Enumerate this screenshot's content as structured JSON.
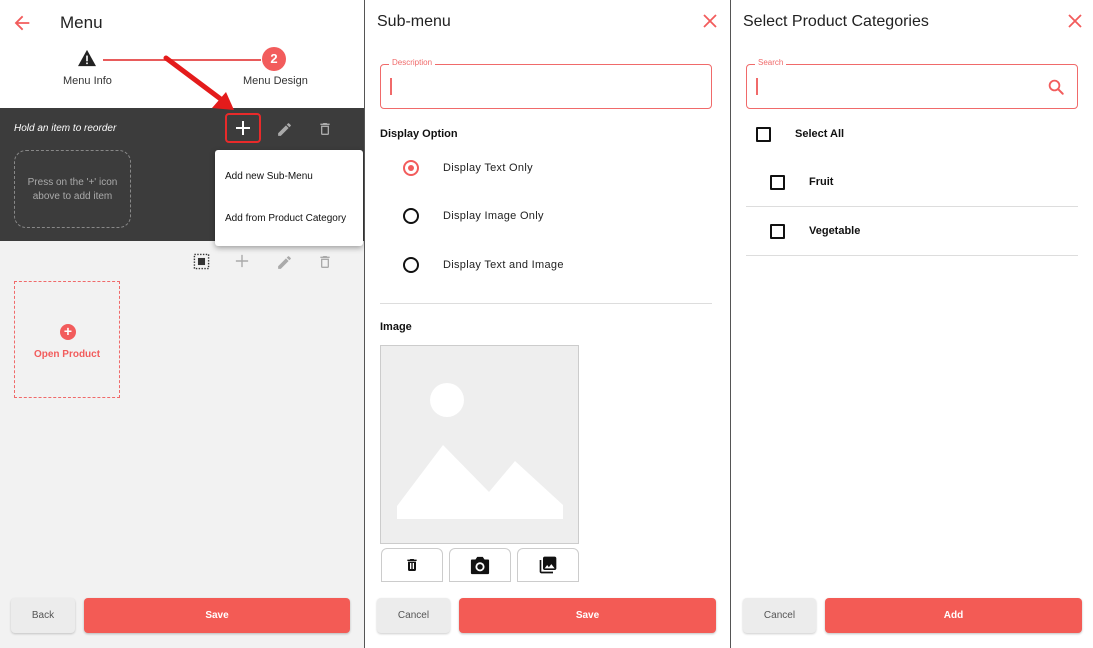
{
  "menu_screen": {
    "title": "Menu",
    "steps": [
      {
        "label": "Menu Info"
      },
      {
        "label": "Menu Design",
        "number": "2"
      }
    ],
    "toolbar_hint": "Hold an item to reorder",
    "empty_placeholder": "Press on the '+' icon above to add item",
    "context_menu": {
      "items": [
        "Add new Sub-Menu",
        "Add from Product Category"
      ]
    },
    "open_product_label": "Open Product",
    "back_label": "Back",
    "save_label": "Save"
  },
  "submenu_screen": {
    "title": "Sub-menu",
    "description_label": "Description",
    "description_value": "",
    "display_option_title": "Display Option",
    "display_options": [
      {
        "label": "Display Text Only",
        "selected": true
      },
      {
        "label": "Display Image Only",
        "selected": false
      },
      {
        "label": "Display Text and Image",
        "selected": false
      }
    ],
    "image_title": "Image",
    "cancel_label": "Cancel",
    "save_label": "Save"
  },
  "categories_screen": {
    "title": "Select Product Categories",
    "search_label": "Search",
    "search_value": "",
    "select_all_label": "Select All",
    "categories": [
      {
        "label": "Fruit",
        "checked": false
      },
      {
        "label": "Vegetable",
        "checked": false
      }
    ],
    "cancel_label": "Cancel",
    "add_label": "Add"
  },
  "colors": {
    "accent": "#f25c5c",
    "dark_toolbar": "#3c3c3c",
    "highlight_border": "#e82a2a"
  }
}
